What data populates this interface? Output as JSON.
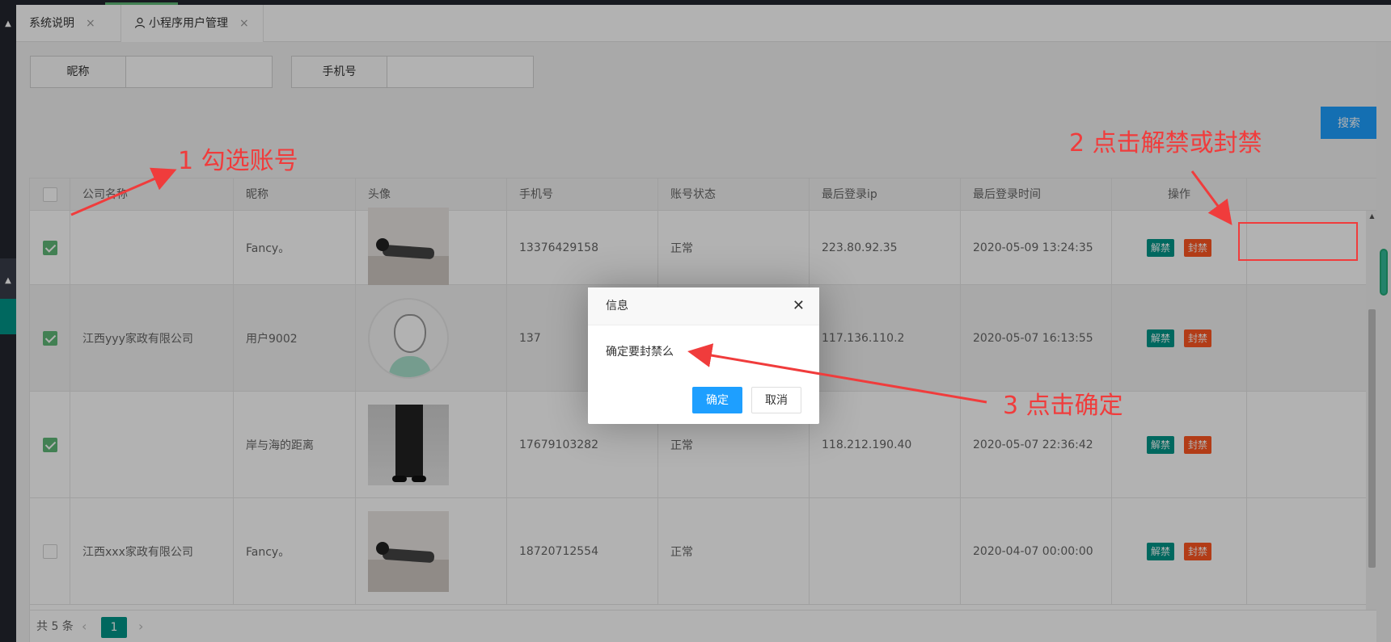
{
  "tabs": [
    {
      "label": "系统说明",
      "close": "×"
    },
    {
      "label": "小程序用户管理",
      "close": "×"
    }
  ],
  "filters": {
    "nickname_label": "昵称",
    "phone_label": "手机号",
    "nickname_value": "",
    "phone_value": ""
  },
  "search_label": "搜索",
  "table": {
    "headers": [
      "公司名称",
      "昵称",
      "头像",
      "手机号",
      "账号状态",
      "最后登录ip",
      "最后登录时间",
      "操作"
    ],
    "rows": [
      {
        "checked": true,
        "company": "",
        "nickname": "Fancy。",
        "avatar": "photo-lying",
        "phone": "13376429158",
        "status": "正常",
        "ip": "223.80.92.35",
        "time": "2020-05-09 13:24:35"
      },
      {
        "checked": true,
        "company": "江西yyy家政有限公司",
        "nickname": "用户9002",
        "avatar": "default-avatar",
        "phone": "137",
        "status": "",
        "ip": "117.136.110.2",
        "time": "2020-05-07 16:13:55"
      },
      {
        "checked": true,
        "company": "",
        "nickname": "岸与海的距离",
        "avatar": "photo-pants",
        "phone": "17679103282",
        "status": "正常",
        "ip": "118.212.190.40",
        "time": "2020-05-07 22:36:42"
      },
      {
        "checked": false,
        "company": "江西xxx家政有限公司",
        "nickname": "Fancy。",
        "avatar": "photo-lying",
        "phone": "18720712554",
        "status": "正常",
        "ip": "",
        "time": "2020-04-07 00:00:00"
      }
    ],
    "unban_label": "解禁",
    "ban_label": "封禁"
  },
  "pagination": {
    "total": "共 5 条",
    "current_page": "1",
    "prev": "‹",
    "next": "›"
  },
  "dialog": {
    "title": "信息",
    "message": "确定要封禁么",
    "ok": "确定",
    "cancel": "取消",
    "close": "✕"
  },
  "annotations": {
    "step1": "1 勾选账号",
    "step2": "2 点击解禁或封禁",
    "step3": "3 点击确定",
    "color": "#f03c3c"
  },
  "colors": {
    "primary": "#009688",
    "blue": "#1e9fff",
    "danger": "#ff5722",
    "checked": "#5fb878"
  }
}
